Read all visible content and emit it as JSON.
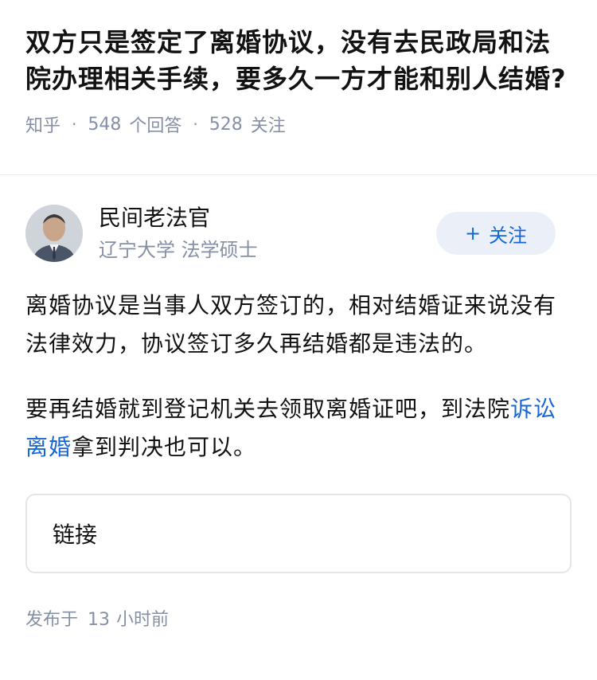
{
  "question": {
    "title": "双方只是签定了离婚协议，没有去民政局和法院办理相关手续，要多久一方才能和别人结婚?",
    "source": "知乎",
    "answers_count": "548",
    "answers_label": "个回答",
    "followers_count": "528",
    "followers_label": "关注"
  },
  "answer": {
    "author_name": "民间老法官",
    "author_bio": "辽宁大学 法学硕士",
    "follow_button_icon": "plus-icon",
    "follow_button_label": "关注",
    "paragraph1": "离婚协议是当事人双方签订的，相对结婚证来说没有法律效力，协议签订多久再结婚都是违法的。",
    "paragraph2_before": "要再结婚就到登记机关去领取离婚证吧，到法院",
    "paragraph2_link": "诉讼离婚",
    "paragraph2_after": "拿到判决也可以。",
    "link_card_label": "链接",
    "published_prefix": "发布于",
    "published_num": "13",
    "published_suffix": "小时前"
  },
  "colors": {
    "link_blue": "#1766d6",
    "meta_gray": "#8590a6",
    "follow_bg": "#ebf0f8"
  }
}
